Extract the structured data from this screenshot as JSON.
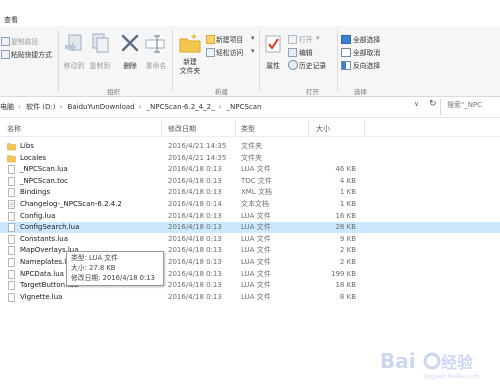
{
  "tabstrip": {
    "view_tab": "查看"
  },
  "ribbon": {
    "clipboard": {
      "copy_path": "复制路径",
      "paste_shortcut": "粘贴快捷方式"
    },
    "organize": {
      "label": "组织",
      "move_to": "移动到",
      "copy_to": "复制到",
      "delete": "删除",
      "rename": "重命名"
    },
    "new": {
      "label": "新建",
      "new_folder": "新建\n文件夹",
      "new_item": "新建项目",
      "easy_access": "轻松访问"
    },
    "open": {
      "label": "打开",
      "properties": "属性",
      "open": "打开",
      "edit": "编辑",
      "history": "历史记录"
    },
    "select": {
      "label": "选择",
      "select_all": "全部选择",
      "select_none": "全部取消",
      "invert": "反向选择"
    }
  },
  "address": {
    "crumbs": [
      "电脑",
      "软件 (D:)",
      "BaiduYunDownload",
      "_NPCScan-6.2_4_2_",
      "_NPCScan"
    ],
    "search_placeholder": "搜索\"_NPC"
  },
  "columns": {
    "name": "名称",
    "date": "修改日期",
    "type": "类型",
    "size": "大小"
  },
  "files": [
    {
      "name": "Libs",
      "date": "2016/4/21 14:35",
      "type": "文件夹",
      "size": "",
      "kind": "folder"
    },
    {
      "name": "Locales",
      "date": "2016/4/21 14:35",
      "type": "文件夹",
      "size": "",
      "kind": "folder"
    },
    {
      "name": "_NPCScan.lua",
      "date": "2016/4/18 0:13",
      "type": "LUA 文件",
      "size": "46 KB",
      "kind": "file"
    },
    {
      "name": "_NPCScan.toc",
      "date": "2016/4/18 0:13",
      "type": "TOC 文件",
      "size": "4 KB",
      "kind": "file"
    },
    {
      "name": "Bindings",
      "date": "2016/4/18 0:13",
      "type": "XML 文档",
      "size": "1 KB",
      "kind": "file"
    },
    {
      "name": "Changelog-_NPCScan-6.2.4.2",
      "date": "2016/4/18 0:14",
      "type": "文本文档",
      "size": "1 KB",
      "kind": "text"
    },
    {
      "name": "Config.lua",
      "date": "2016/4/18 0:13",
      "type": "LUA 文件",
      "size": "16 KB",
      "kind": "file"
    },
    {
      "name": "ConfigSearch.lua",
      "date": "2016/4/18 0:13",
      "type": "LUA 文件",
      "size": "28 KB",
      "kind": "file",
      "selected": true
    },
    {
      "name": "Constants.lua",
      "date": "2016/4/18 0:13",
      "type": "LUA 文件",
      "size": "9 KB",
      "kind": "file"
    },
    {
      "name": "MapOverlays.lua",
      "date": "2016/4/18 0:13",
      "type": "LUA 文件",
      "size": "2 KB",
      "kind": "file"
    },
    {
      "name": "Nameplates.lua",
      "date": "2016/4/18 0:13",
      "type": "LUA 文件",
      "size": "2 KB",
      "kind": "file"
    },
    {
      "name": "NPCData.lua",
      "date": "2016/4/18 0:13",
      "type": "LUA 文件",
      "size": "199 KB",
      "kind": "file"
    },
    {
      "name": "TargetButton.lua",
      "date": "2016/4/18 0:13",
      "type": "LUA 文件",
      "size": "18 KB",
      "kind": "file"
    },
    {
      "name": "Vignette.lua",
      "date": "2016/4/18 0:13",
      "type": "LUA 文件",
      "size": "8 KB",
      "kind": "file"
    }
  ],
  "tooltip": {
    "type_line": "类型: LUA 文件",
    "size_line": "大小: 27.8 KB",
    "date_line": "修改日期: 2016/4/18 0:13"
  },
  "colors": {
    "selected_row": "#cce8ff",
    "folder": "#f3c64f",
    "accent": "#1e6fc8"
  }
}
